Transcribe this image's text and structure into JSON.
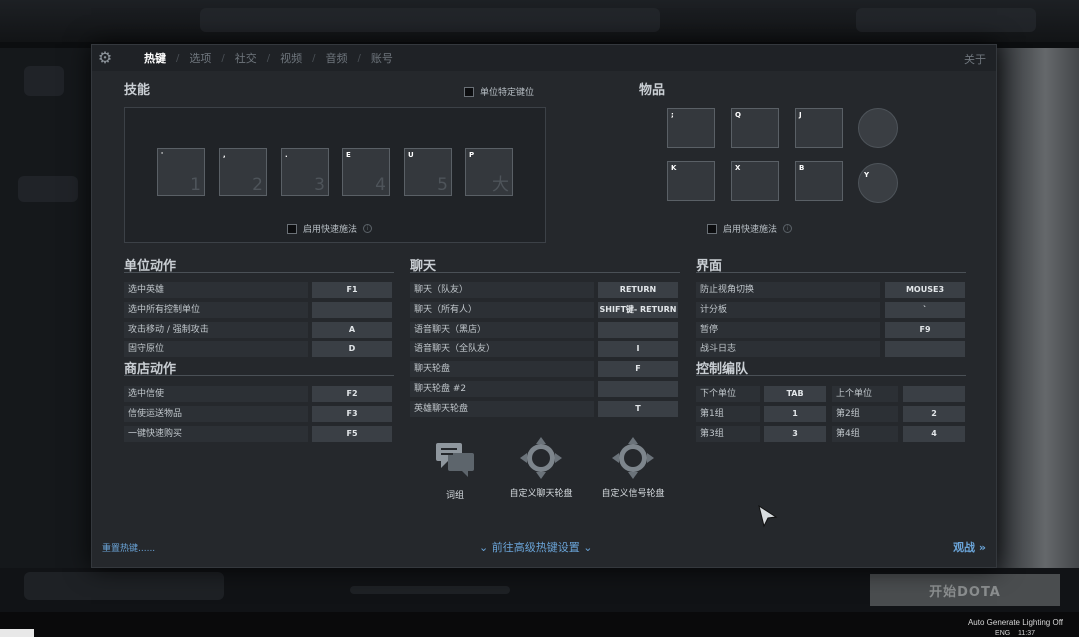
{
  "tabs": [
    {
      "label": "热键",
      "active": true
    },
    {
      "label": "选项",
      "active": false
    },
    {
      "label": "社交",
      "active": false
    },
    {
      "label": "视频",
      "active": false
    },
    {
      "label": "音频",
      "active": false
    },
    {
      "label": "账号",
      "active": false
    }
  ],
  "about_label": "关于",
  "skills": {
    "title": "技能",
    "unit_specific_label": "单位特定键位",
    "slots": [
      {
        "key": "'",
        "num": "1"
      },
      {
        "key": ",",
        "num": "2"
      },
      {
        "key": ".",
        "num": "3"
      },
      {
        "key": "E",
        "num": "4"
      },
      {
        "key": "U",
        "num": "5"
      },
      {
        "key": "P",
        "num": "大"
      }
    ],
    "quick_cast_label": "启用快速施法"
  },
  "items": {
    "title": "物品",
    "slots": [
      ";",
      "Q",
      "J",
      "K",
      "X",
      "B"
    ],
    "neutral_key": "Y",
    "quick_cast_label": "启用快速施法"
  },
  "unit_actions": {
    "title": "单位动作",
    "rows": [
      {
        "label": "选中英雄",
        "key": "F1"
      },
      {
        "label": "选中所有控制单位",
        "key": ""
      },
      {
        "label": "攻击移动 / 强制攻击",
        "key": "A"
      },
      {
        "label": "固守原位",
        "key": "D"
      }
    ]
  },
  "shop_actions": {
    "title": "商店动作",
    "rows": [
      {
        "label": "选中信使",
        "key": "F2"
      },
      {
        "label": "信使运送物品",
        "key": "F3"
      },
      {
        "label": "一键快速购买",
        "key": "F5"
      }
    ]
  },
  "chat": {
    "title": "聊天",
    "rows": [
      {
        "label": "聊天（队友）",
        "key": "RETURN"
      },
      {
        "label": "聊天（所有人）",
        "key": "SHIFT键- RETURN"
      },
      {
        "label": "语音聊天（黑店）",
        "key": ""
      },
      {
        "label": "语音聊天（全队友）",
        "key": "I"
      },
      {
        "label": "聊天轮盘",
        "key": "F"
      },
      {
        "label": "聊天轮盘 #2",
        "key": ""
      },
      {
        "label": "英雄聊天轮盘",
        "key": "T"
      }
    ]
  },
  "interface": {
    "title": "界面",
    "rows": [
      {
        "label": "防止视角切换",
        "key": "MOUSE3"
      },
      {
        "label": "计分板",
        "key": "`"
      },
      {
        "label": "暂停",
        "key": "F9"
      },
      {
        "label": "战斗日志",
        "key": ""
      }
    ]
  },
  "control_groups": {
    "title": "控制编队",
    "rows": [
      {
        "l1": "下个单位",
        "k1": "TAB",
        "l2": "上个单位",
        "k2": ""
      },
      {
        "l1": "第1组",
        "k1": "1",
        "l2": "第2组",
        "k2": "2"
      },
      {
        "l1": "第3组",
        "k1": "3",
        "l2": "第4组",
        "k2": "4"
      }
    ]
  },
  "wheels": [
    {
      "label": "词组",
      "icon": "chat-bubble-icon"
    },
    {
      "label": "自定义聊天轮盘",
      "icon": "chat-wheel-icon"
    },
    {
      "label": "自定义信号轮盘",
      "icon": "ping-wheel-icon"
    }
  ],
  "footer": {
    "reset": "重置热键......",
    "advanced": "前往高级热键设置",
    "spectate": "观战 »"
  },
  "background": {
    "play_button": "开始DOTA",
    "taskbar_text": "Auto Generate Lighting Off",
    "taskbar_lang": "ENG",
    "taskbar_time": "11:37"
  }
}
